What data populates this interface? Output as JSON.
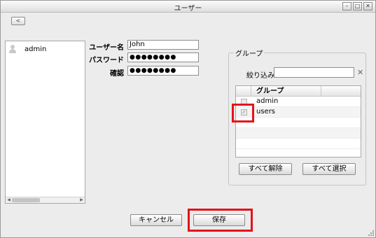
{
  "window": {
    "title": "ユーザー"
  },
  "toolbar": {
    "back_symbol": "<"
  },
  "users": [
    {
      "name": "admin"
    }
  ],
  "form": {
    "username_label": "ユーザー名",
    "username_value": "John",
    "password_label": "パスワード",
    "password_value": "●●●●●●●●",
    "confirm_label": "確認",
    "confirm_value": "●●●●●●●●"
  },
  "group": {
    "legend": "グループ",
    "filter_label": "絞り込み",
    "filter_value": "",
    "column_header": "グループ",
    "rows": [
      {
        "name": "admin",
        "checked": false
      },
      {
        "name": "users",
        "checked": true
      }
    ],
    "clear_all_label": "すべて解除",
    "select_all_label": "すべて選択"
  },
  "footer": {
    "cancel_label": "キャンセル",
    "save_label": "保存"
  },
  "colors": {
    "highlight": "#e5121a"
  }
}
